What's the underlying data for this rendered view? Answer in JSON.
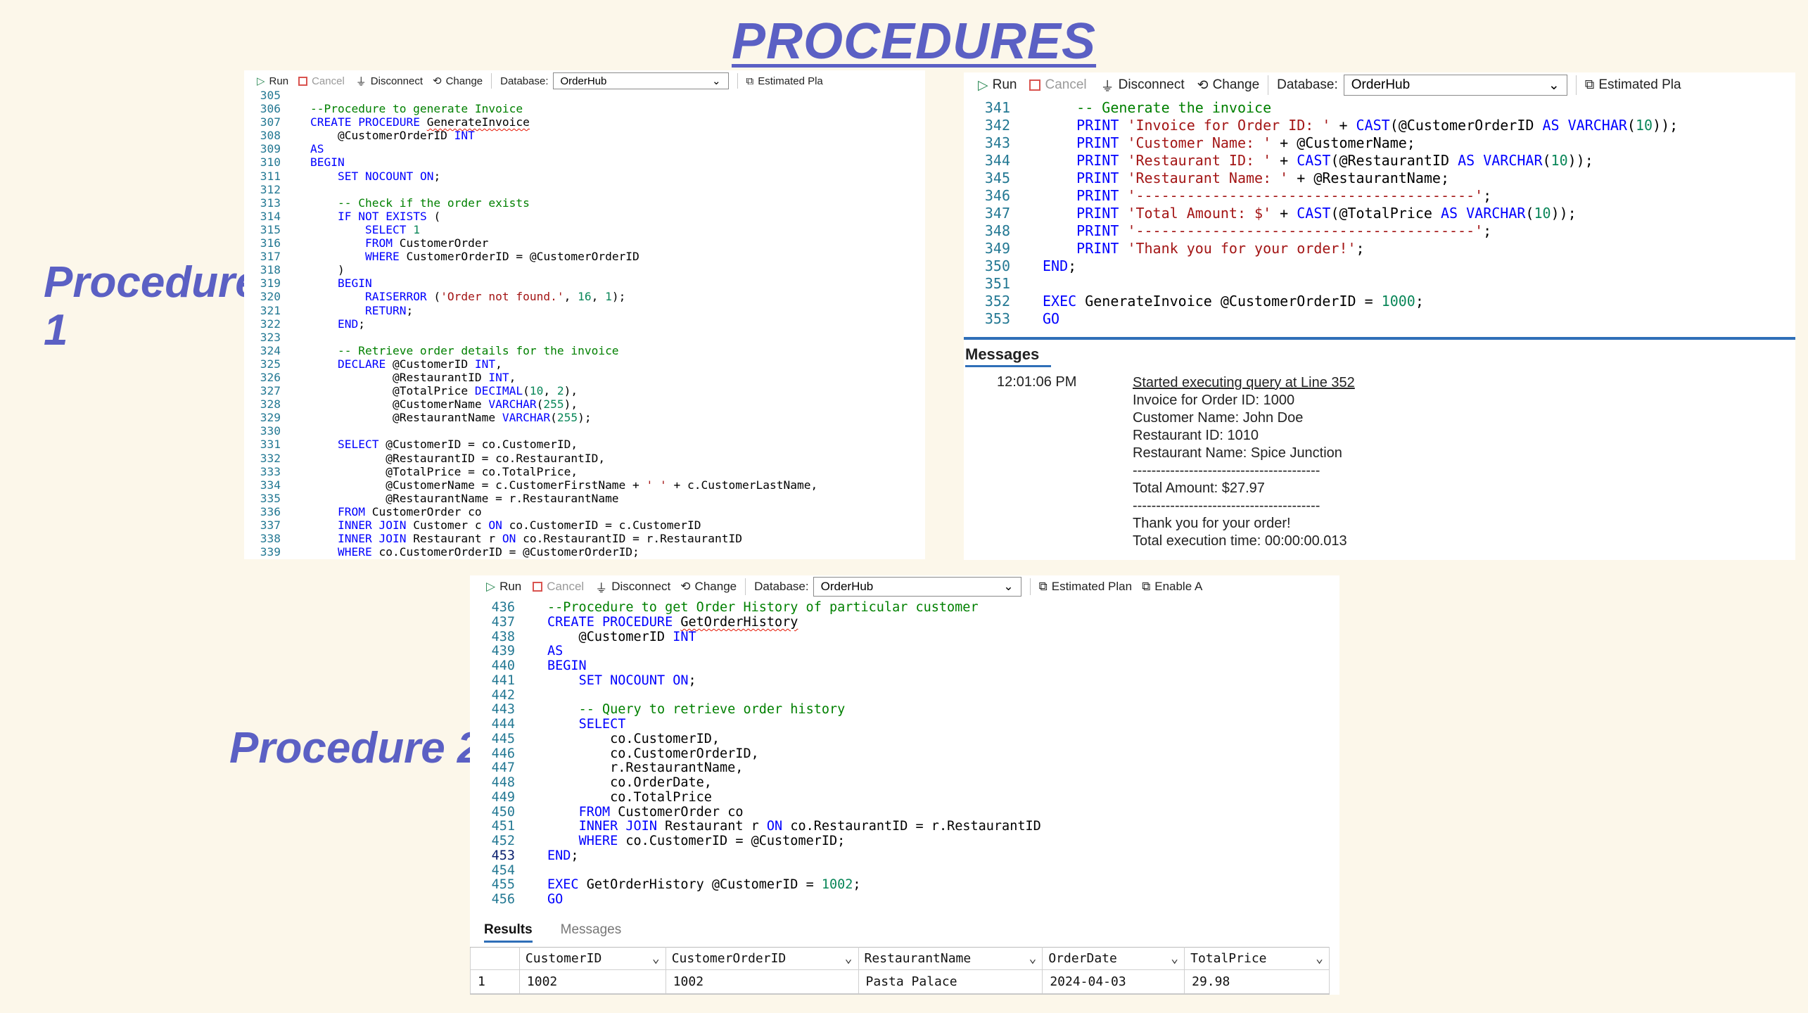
{
  "title": "PROCEDURES",
  "labels": {
    "procedure1": "Procedure 1",
    "procedure2": "Procedure 2"
  },
  "toolbar": {
    "run": "Run",
    "cancel": "Cancel",
    "disconnect": "Disconnect",
    "change": "Change",
    "database_label": "Database:",
    "database_value": "OrderHub",
    "estimated_plan": "Estimated Plan",
    "estimated_plan_truncated": "Estimated Pla",
    "enable": "Enable A"
  },
  "editor1": {
    "lines": [
      {
        "n": "305",
        "t": ""
      },
      {
        "n": "306",
        "t": "--Procedure to generate Invoice"
      },
      {
        "n": "307",
        "t": "CREATE PROCEDURE GenerateInvoice"
      },
      {
        "n": "308",
        "t": "    @CustomerOrderID INT"
      },
      {
        "n": "309",
        "t": "AS"
      },
      {
        "n": "310",
        "t": "BEGIN"
      },
      {
        "n": "311",
        "t": "    SET NOCOUNT ON;"
      },
      {
        "n": "312",
        "t": ""
      },
      {
        "n": "313",
        "t": "    -- Check if the order exists"
      },
      {
        "n": "314",
        "t": "    IF NOT EXISTS ("
      },
      {
        "n": "315",
        "t": "        SELECT 1"
      },
      {
        "n": "316",
        "t": "        FROM CustomerOrder"
      },
      {
        "n": "317",
        "t": "        WHERE CustomerOrderID = @CustomerOrderID"
      },
      {
        "n": "318",
        "t": "    )"
      },
      {
        "n": "319",
        "t": "    BEGIN"
      },
      {
        "n": "320",
        "t": "        RAISERROR ('Order not found.', 16, 1);"
      },
      {
        "n": "321",
        "t": "        RETURN;"
      },
      {
        "n": "322",
        "t": "    END;"
      },
      {
        "n": "323",
        "t": ""
      },
      {
        "n": "324",
        "t": "    -- Retrieve order details for the invoice"
      },
      {
        "n": "325",
        "t": "    DECLARE @CustomerID INT,"
      },
      {
        "n": "326",
        "t": "            @RestaurantID INT,"
      },
      {
        "n": "327",
        "t": "            @TotalPrice DECIMAL(10, 2),"
      },
      {
        "n": "328",
        "t": "            @CustomerName VARCHAR(255),"
      },
      {
        "n": "329",
        "t": "            @RestaurantName VARCHAR(255);"
      },
      {
        "n": "330",
        "t": ""
      },
      {
        "n": "331",
        "t": "    SELECT @CustomerID = co.CustomerID,"
      },
      {
        "n": "332",
        "t": "           @RestaurantID = co.RestaurantID,"
      },
      {
        "n": "333",
        "t": "           @TotalPrice = co.TotalPrice,"
      },
      {
        "n": "334",
        "t": "           @CustomerName = c.CustomerFirstName + ' ' + c.CustomerLastName,"
      },
      {
        "n": "335",
        "t": "           @RestaurantName = r.RestaurantName"
      },
      {
        "n": "336",
        "t": "    FROM CustomerOrder co"
      },
      {
        "n": "337",
        "t": "    INNER JOIN Customer c ON co.CustomerID = c.CustomerID"
      },
      {
        "n": "338",
        "t": "    INNER JOIN Restaurant r ON co.RestaurantID = r.RestaurantID"
      },
      {
        "n": "339",
        "t": "    WHERE co.CustomerOrderID = @CustomerOrderID;"
      }
    ]
  },
  "editor2": {
    "lines": [
      {
        "n": "341",
        "t": "    -- Generate the invoice"
      },
      {
        "n": "342",
        "t": "    PRINT 'Invoice for Order ID: ' + CAST(@CustomerOrderID AS VARCHAR(10));"
      },
      {
        "n": "343",
        "t": "    PRINT 'Customer Name: ' + @CustomerName;"
      },
      {
        "n": "344",
        "t": "    PRINT 'Restaurant ID: ' + CAST(@RestaurantID AS VARCHAR(10));"
      },
      {
        "n": "345",
        "t": "    PRINT 'Restaurant Name: ' + @RestaurantName;"
      },
      {
        "n": "346",
        "t": "    PRINT '----------------------------------------';"
      },
      {
        "n": "347",
        "t": "    PRINT 'Total Amount: $' + CAST(@TotalPrice AS VARCHAR(10));"
      },
      {
        "n": "348",
        "t": "    PRINT '----------------------------------------';"
      },
      {
        "n": "349",
        "t": "    PRINT 'Thank you for your order!';"
      },
      {
        "n": "350",
        "t": "END;"
      },
      {
        "n": "351",
        "t": ""
      },
      {
        "n": "352",
        "t": "EXEC GenerateInvoice @CustomerOrderID = 1000;"
      },
      {
        "n": "353",
        "t": "GO"
      }
    ],
    "messages_title": "Messages",
    "message_time": "12:01:06 PM",
    "message_lines": [
      "Started executing query at Line 352",
      "Invoice for Order ID: 1000",
      "Customer Name: John Doe",
      "Restaurant ID: 1010",
      "Restaurant Name: Spice Junction",
      "----------------------------------------",
      "Total Amount: $27.97",
      "----------------------------------------",
      "Thank you for your order!",
      "Total execution time: 00:00:00.013"
    ]
  },
  "editor3": {
    "lines": [
      {
        "n": "436",
        "t": "--Procedure to get Order History of particular customer"
      },
      {
        "n": "437",
        "t": "CREATE PROCEDURE GetOrderHistory"
      },
      {
        "n": "438",
        "t": "    @CustomerID INT"
      },
      {
        "n": "439",
        "t": "AS"
      },
      {
        "n": "440",
        "t": "BEGIN"
      },
      {
        "n": "441",
        "t": "    SET NOCOUNT ON;"
      },
      {
        "n": "442",
        "t": ""
      },
      {
        "n": "443",
        "t": "    -- Query to retrieve order history"
      },
      {
        "n": "444",
        "t": "    SELECT"
      },
      {
        "n": "445",
        "t": "        co.CustomerID,"
      },
      {
        "n": "446",
        "t": "        co.CustomerOrderID,"
      },
      {
        "n": "447",
        "t": "        r.RestaurantName,"
      },
      {
        "n": "448",
        "t": "        co.OrderDate,"
      },
      {
        "n": "449",
        "t": "        co.TotalPrice"
      },
      {
        "n": "450",
        "t": "    FROM CustomerOrder co"
      },
      {
        "n": "451",
        "t": "    INNER JOIN Restaurant r ON co.RestaurantID = r.RestaurantID"
      },
      {
        "n": "452",
        "t": "    WHERE co.CustomerID = @CustomerID;"
      },
      {
        "n": "453",
        "t": "END;"
      },
      {
        "n": "454",
        "t": ""
      },
      {
        "n": "455",
        "t": "EXEC GetOrderHistory @CustomerID = 1002;"
      },
      {
        "n": "456",
        "t": "GO"
      }
    ],
    "tabs": [
      "Results",
      "Messages"
    ],
    "columns": [
      "",
      "CustomerID",
      "CustomerOrderID",
      "RestaurantName",
      "OrderDate",
      "TotalPrice"
    ],
    "rows": [
      [
        "1",
        "1002",
        "1002",
        "Pasta Palace",
        "2024-04-03",
        "29.98"
      ]
    ]
  }
}
